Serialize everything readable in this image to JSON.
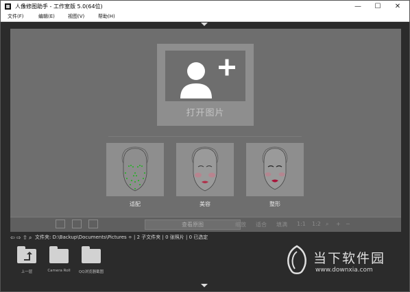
{
  "window": {
    "title": "人像修图助手 - 工作室版 5.0(64位)",
    "controls": {
      "minimize": "—",
      "maximize": "☐",
      "close": "✕"
    }
  },
  "menu": [
    {
      "label": "文件(F)"
    },
    {
      "label": "编辑(E)"
    },
    {
      "label": "视图(V)"
    },
    {
      "label": "帮助(H)"
    }
  ],
  "workspace": {
    "open_label": "打开图片",
    "faces": [
      {
        "label": "适配",
        "icon": "face-dots-icon"
      },
      {
        "label": "美容",
        "icon": "face-makeup-icon"
      },
      {
        "label": "整形",
        "icon": "face-reshape-icon"
      }
    ]
  },
  "toolbar": {
    "view_original": "查看原图",
    "zoom": "缩放",
    "fit": "适合",
    "fill": "填满",
    "ratio_1": "1:1",
    "ratio_2": "1:2",
    "plus": "+",
    "minus": "−"
  },
  "pathbar": {
    "text": "文件夹: D:\\Backup\\Documents\\Pictures ÷ | 2 子文件夹 | 0 张照片 | 0 已选定"
  },
  "files": [
    {
      "label": "上一层",
      "icon": "folder-up-icon"
    },
    {
      "label": "Camera Roll",
      "icon": "folder-icon"
    },
    {
      "label": "QQ浏览器截图",
      "icon": "folder-icon"
    }
  ],
  "watermark": {
    "name": "当下软件园",
    "url": "www.downxia.com"
  },
  "colors": {
    "workspace_bg": "#6e6e6e",
    "card_bg": "#8e8e8e",
    "dark_bg": "#2b2b2b"
  }
}
